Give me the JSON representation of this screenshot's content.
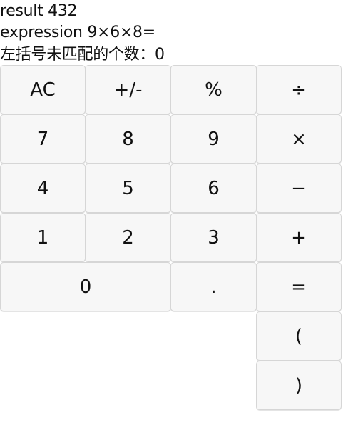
{
  "display": {
    "result_label": "result 432",
    "expression_label": "expression 9×6×8=",
    "unmatched_paren_label": "左括号未匹配的个数：0"
  },
  "keys": {
    "clear": "AC",
    "negate": "+/-",
    "percent": "%",
    "divide": "÷",
    "seven": "7",
    "eight": "8",
    "nine": "9",
    "multiply": "×",
    "four": "4",
    "five": "5",
    "six": "6",
    "minus": "−",
    "one": "1",
    "two": "2",
    "three": "3",
    "plus": "+",
    "zero": "0",
    "decimal": ".",
    "equals": "=",
    "open_paren": "(",
    "close_paren": ")"
  }
}
